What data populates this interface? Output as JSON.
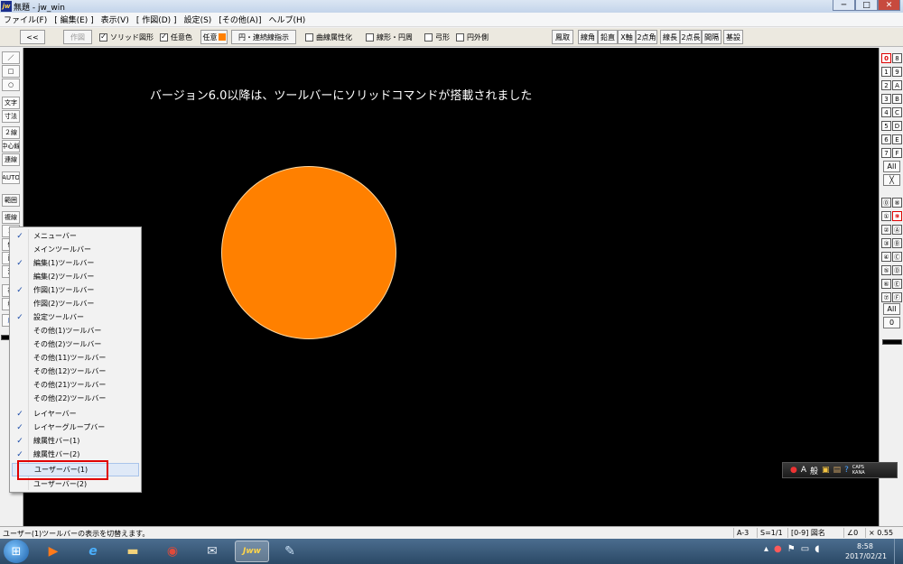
{
  "window": {
    "title": "無題 - jw_win",
    "app_icon_text": "jw",
    "min": "─",
    "max": "□",
    "close": "✕"
  },
  "menubar": [
    "ファイル(F)",
    "[ 編集(E) ]",
    "表示(V)",
    "[ 作図(D) ]",
    "設定(S)",
    "[その他(A)]",
    "ヘルプ(H)"
  ],
  "toolbar": {
    "nav_back": "<<",
    "sakuzu": "作図",
    "solid_shape": "ソリッド図形",
    "any_color_check": "任意色",
    "any_color_btn": "任意",
    "circle_cont": "円・連続線指示",
    "curve_attr": "曲線属性化",
    "line_circle": "線形・円周",
    "arc": "弓形",
    "outer_circle": "円外側",
    "right_buttons": [
      "鳳取",
      "線角",
      "鉛直",
      "X軸",
      "2点角",
      "線長",
      "2点長",
      "間隔",
      "基設"
    ]
  },
  "left_toolbar": [
    "／",
    "□",
    "○",
    "文字",
    "寸法",
    "２線",
    "中心線",
    "連線",
    "AUTO",
    "範囲",
    "複線",
    "コ",
    "伸",
    "面",
    "消",
    "複",
    "移",
    "戻"
  ],
  "canvas": {
    "text": "バージョン6.0以降は、ツールバーにソリッドコマンドが搭載されました"
  },
  "right_toolbar": {
    "group1": [
      [
        "0",
        "8"
      ],
      [
        "1",
        "9"
      ],
      [
        "2",
        "A"
      ],
      [
        "3",
        "B"
      ],
      [
        "4",
        "C"
      ],
      [
        "5",
        "D"
      ],
      [
        "6",
        "E"
      ],
      [
        "7",
        "F"
      ]
    ],
    "all1": "All",
    "x": "╳",
    "group2": [
      [
        "⓪",
        "⑧"
      ],
      [
        "①",
        "⑨"
      ],
      [
        "②",
        "Ⓐ"
      ],
      [
        "③",
        "Ⓑ"
      ],
      [
        "④",
        "Ⓒ"
      ],
      [
        "⑤",
        "Ⓓ"
      ],
      [
        "⑥",
        "Ⓔ"
      ],
      [
        "⑦",
        "Ⓕ"
      ]
    ],
    "all2": "All",
    "zero": "0"
  },
  "context_menu": {
    "items": [
      {
        "label": "メニューバー",
        "checked": "✓"
      },
      {
        "label": "メインツールバー",
        "checked": ""
      },
      {
        "label": "編集(1)ツールバー",
        "checked": "✓"
      },
      {
        "label": "編集(2)ツールバー",
        "checked": ""
      },
      {
        "label": "作図(1)ツールバー",
        "checked": "✓"
      },
      {
        "label": "作図(2)ツールバー",
        "checked": ""
      },
      {
        "label": "設定ツールバー",
        "checked": "✓"
      },
      {
        "label": "その他(1)ツールバー",
        "checked": ""
      },
      {
        "label": "その他(2)ツールバー",
        "checked": ""
      },
      {
        "label": "その他(11)ツールバー",
        "checked": ""
      },
      {
        "label": "その他(12)ツールバー",
        "checked": ""
      },
      {
        "label": "その他(21)ツールバー",
        "checked": ""
      },
      {
        "label": "その他(22)ツールバー",
        "checked": ""
      },
      {
        "label": "レイヤーバー",
        "checked": "✓"
      },
      {
        "label": "レイヤーグループバー",
        "checked": "✓"
      },
      {
        "label": "線属性バー(1)",
        "checked": "✓"
      },
      {
        "label": "線属性バー(2)",
        "checked": "✓"
      },
      {
        "label": "ユーザーバー(1)",
        "checked": ""
      },
      {
        "label": "ユーザーバー(2)",
        "checked": ""
      }
    ]
  },
  "ime_bar": {
    "mode": "A",
    "kana": "般",
    "caps": "CAPS",
    "kana_lock": "KANA"
  },
  "statusbar": {
    "message": "ユーザー(1)ツールバーの表示を切替えます。",
    "paper": "A-3",
    "scale": "S=1/1",
    "layer": "[0-9] 図名",
    "angle": "∠0",
    "zoom": "× 0.55"
  },
  "taskbar": {
    "time": "8:58",
    "date": "2017/02/21",
    "start": "⊞",
    "jw_label": "Jww"
  }
}
